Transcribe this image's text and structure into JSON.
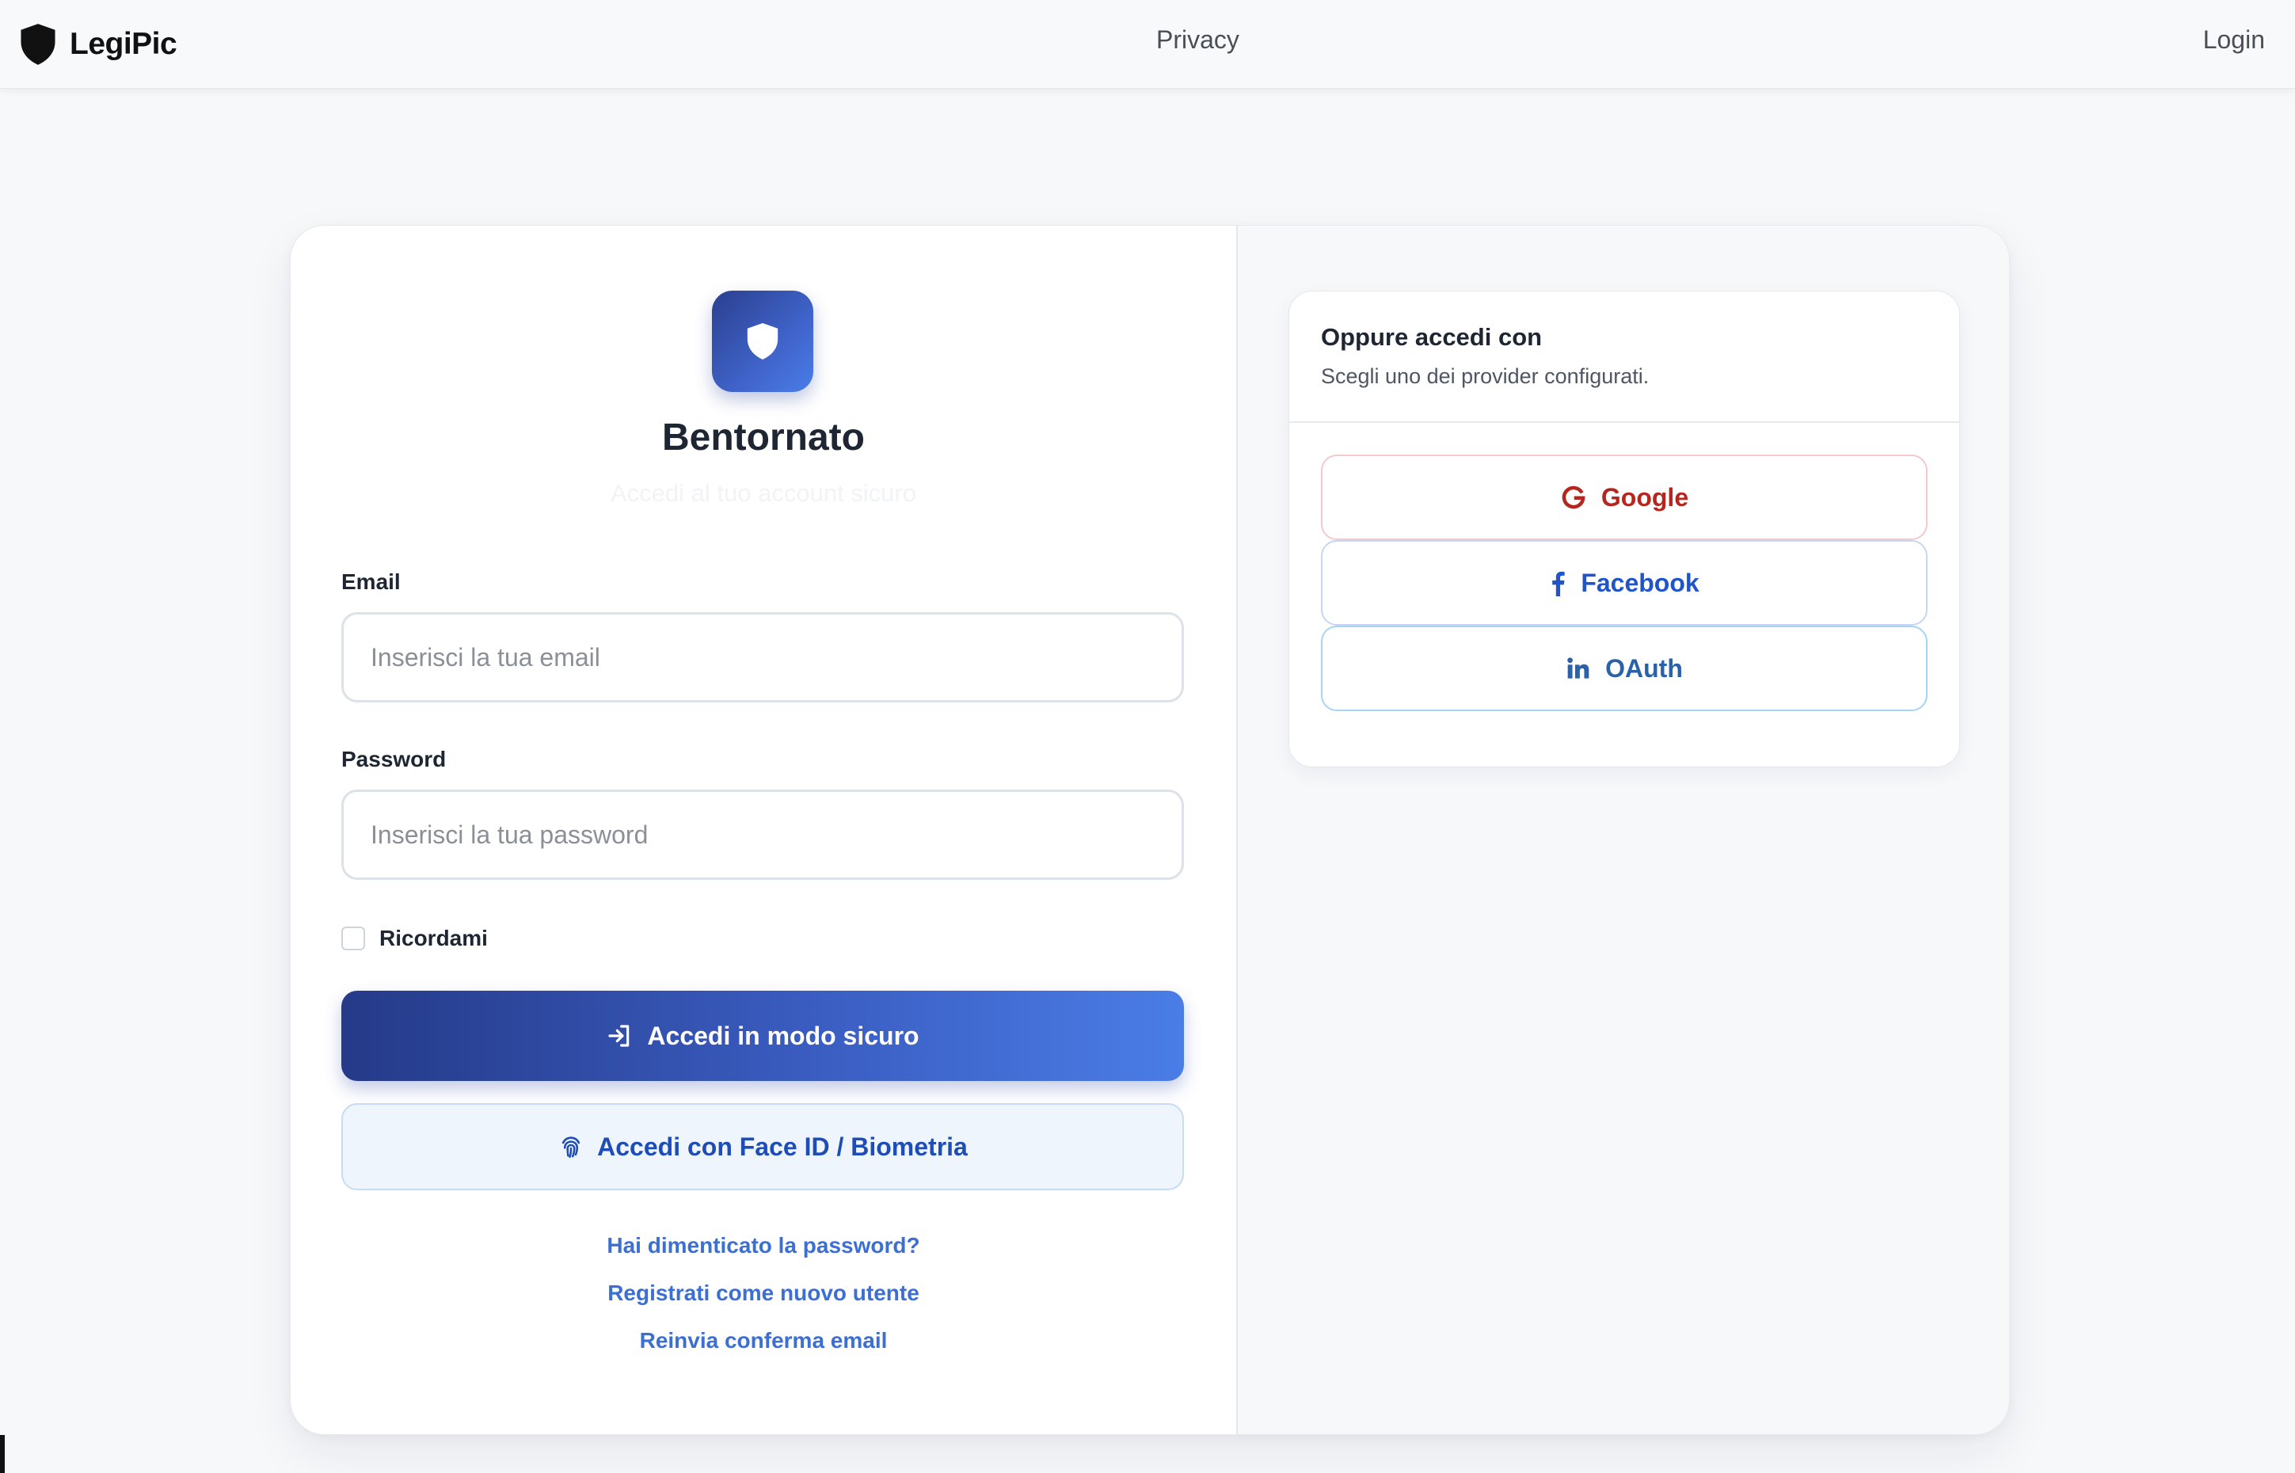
{
  "navbar": {
    "brand_name": "LegiPic",
    "brand_icon": "shield-icon",
    "privacy_link": "Privacy",
    "login_link": "Login"
  },
  "login": {
    "logo_icon": "shield-icon",
    "title": "Bentornato",
    "subtitle": "Accedi al tuo account sicuro",
    "email_label": "Email",
    "email_placeholder": "Inserisci la tua email",
    "email_value": "",
    "password_label": "Password",
    "password_placeholder": "Inserisci la tua password",
    "password_value": "",
    "remember_label": "Ricordami",
    "remember_checked": false,
    "submit_label": "Accedi in modo sicuro",
    "submit_icon": "sign-in-icon",
    "biometric_label": "Accedi con Face ID / Biometria",
    "biometric_icon": "fingerprint-icon",
    "links": {
      "forgot_password": "Hai dimenticato la password?",
      "register": "Registrati come nuovo utente",
      "resend_confirmation": "Reinvia conferma email"
    }
  },
  "providers": {
    "title": "Oppure accedi con",
    "subtitle": "Scegli uno dei provider configurati.",
    "google": {
      "label": "Google",
      "icon": "google-icon",
      "color": "#b5261e"
    },
    "facebook": {
      "label": "Facebook",
      "icon": "facebook-icon",
      "color": "#2154c9"
    },
    "oauth": {
      "label": "OAuth",
      "icon": "linkedin-icon",
      "color": "#2b61a8"
    }
  },
  "colors": {
    "primary_gradient_start": "#253a88",
    "primary_gradient_end": "#4a7de6",
    "link": "#3b6fd4",
    "page_background": "#f7f8fa"
  }
}
